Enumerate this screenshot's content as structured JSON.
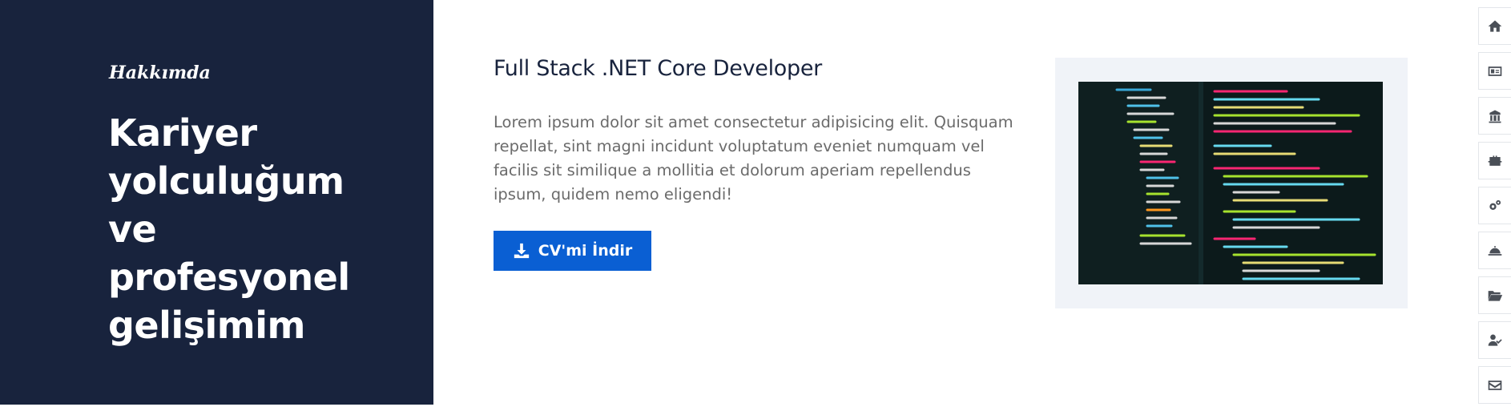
{
  "sidebar": {
    "eyebrow": "Hakkımda",
    "headline": "Kariyer yolculuğum ve profesyonel gelişimim"
  },
  "main": {
    "job_title": "Full Stack .NET Core Developer",
    "description": "Lorem ipsum dolor sit amet consectetur adipisicing elit. Quisquam repellat, sint magni incidunt voluptatum eveniet numquam vel facilis sit similique a mollitia et dolorum aperiam repellendus ipsum, quidem nemo eligendi!",
    "cv_button_label": "CV'mi İndir",
    "cv_button_icon": "download-icon"
  },
  "image": {
    "subject": "code-editor-screenshot"
  },
  "side_nav": {
    "items": [
      {
        "icon": "home-icon"
      },
      {
        "icon": "id-card-icon"
      },
      {
        "icon": "school-icon"
      },
      {
        "icon": "briefcase-icon"
      },
      {
        "icon": "gears-icon"
      },
      {
        "icon": "bell-concierge-icon"
      },
      {
        "icon": "folder-open-icon"
      },
      {
        "icon": "user-check-icon"
      },
      {
        "icon": "envelope-icon"
      }
    ]
  },
  "colors": {
    "sidebar_bg": "#18233d",
    "accent_button": "#0a5fd3",
    "title_text": "#18233d",
    "body_text": "#6b6b6b",
    "image_frame": "#f0f3f8"
  }
}
